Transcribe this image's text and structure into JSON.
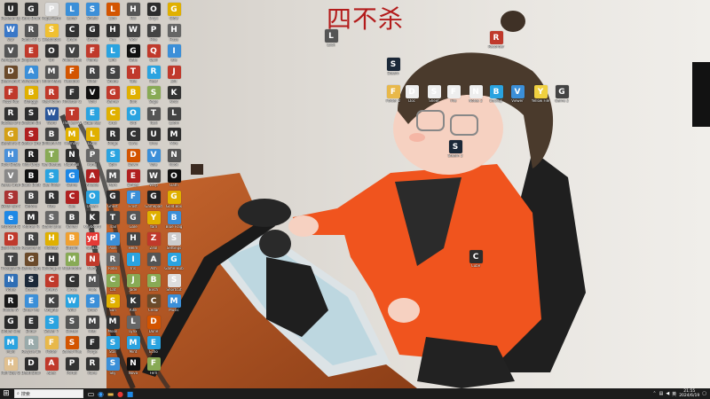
{
  "wallpaper": {
    "title": "四不杀"
  },
  "desktop_icons": [
    {
      "label": "Reslead Up",
      "color": "#2b2b2b",
      "g": "U"
    },
    {
      "label": "War",
      "color": "#3a78c8",
      "g": "W"
    },
    {
      "label": "Verlagerun Messum",
      "color": "#555",
      "g": "V"
    },
    {
      "label": "Dead and Breaken",
      "color": "#6b4a2a",
      "g": "D"
    },
    {
      "label": "Fuzzl Rut",
      "color": "#c0392b",
      "g": "F"
    },
    {
      "label": "Racket of the Bikes",
      "color": "#333",
      "g": "R"
    },
    {
      "label": "Geraint's Geoum",
      "color": "#d4a017",
      "g": "G"
    },
    {
      "label": "Hold Shake",
      "color": "#4a90d9",
      "g": "H"
    },
    {
      "label": "Verse Chart Charter",
      "color": "#888",
      "g": "V"
    },
    {
      "label": "Siklar ein Manaraksen",
      "color": "#a33",
      "g": "S"
    },
    {
      "label": "Microsoft Edge",
      "color": "#1e88e5",
      "g": "e"
    },
    {
      "label": "Dark Reckon",
      "color": "#c0392b",
      "g": "D"
    },
    {
      "label": "Thought Rock",
      "color": "#444",
      "g": "T"
    },
    {
      "label": "Notes",
      "color": "#2f6eb5",
      "g": "N"
    },
    {
      "label": "Riddle IV",
      "color": "#1a1a1a",
      "g": "R"
    },
    {
      "label": "Global Chamber",
      "color": "#2b2b2b",
      "g": "G"
    },
    {
      "label": "Muki",
      "color": "#2aa3e0",
      "g": "M"
    },
    {
      "label": "Half Day Game",
      "color": "#e0c090",
      "g": "H"
    },
    {
      "label": "Guru Brain",
      "color": "#333",
      "g": "G"
    },
    {
      "label": "Radio RP 175",
      "color": "#555",
      "g": "R"
    },
    {
      "label": "Emporium Game",
      "color": "#c0392b",
      "g": "E"
    },
    {
      "label": "Advanced Setup",
      "color": "#3b8fd8",
      "g": "A"
    },
    {
      "label": "Blarggy",
      "color": "#e0b000",
      "g": "B"
    },
    {
      "label": "Shalom Sheen",
      "color": "#2d2d2d",
      "g": "S"
    },
    {
      "label": "Stellar Dreams",
      "color": "#b02020",
      "g": "S"
    },
    {
      "label": "Riot Drop",
      "color": "#222",
      "g": "R"
    },
    {
      "label": "Black Book",
      "color": "#111",
      "g": "B"
    },
    {
      "label": "Before",
      "color": "#444",
      "g": "B"
    },
    {
      "label": "Murder R",
      "color": "#333",
      "g": "M"
    },
    {
      "label": "Reasons to Physical",
      "color": "#444",
      "g": "R"
    },
    {
      "label": "Game Spreadsheet",
      "color": "#6b4a2a",
      "g": "G"
    },
    {
      "label": "Steam",
      "color": "#1b2838",
      "g": "S"
    },
    {
      "label": "Enter Me",
      "color": "#3b8fd8",
      "g": "E"
    },
    {
      "label": "Ender",
      "color": "#333",
      "g": "E"
    },
    {
      "label": "Recycle Bin",
      "color": "#9aa",
      "g": "R"
    },
    {
      "label": "DeathDoor",
      "color": "#2d2d2d",
      "g": "D"
    },
    {
      "label": "PaperTerm",
      "color": "#ddd",
      "g": "P"
    },
    {
      "label": "Sketchbox",
      "color": "#f0c030",
      "g": "S"
    },
    {
      "label": "Ori",
      "color": "#333",
      "g": "O"
    },
    {
      "label": "Mind Matter",
      "color": "#555",
      "g": "M"
    },
    {
      "label": "Red Room",
      "color": "#c0392b",
      "g": "R"
    },
    {
      "label": "Word",
      "color": "#2b579a",
      "g": "W"
    },
    {
      "label": "Brilliant Mine",
      "color": "#444",
      "g": "B"
    },
    {
      "label": "Tea Beauty",
      "color": "#8a5",
      "g": "T"
    },
    {
      "label": "Sea Rider",
      "color": "#2aa3e0",
      "g": "S"
    },
    {
      "label": "Rise",
      "color": "#333",
      "g": "R"
    },
    {
      "label": "Stand Line",
      "color": "#666",
      "g": "S"
    },
    {
      "label": "Holiday",
      "color": "#e0b000",
      "g": "H"
    },
    {
      "label": "Holdings in Bloodskell",
      "color": "#333",
      "g": "H"
    },
    {
      "label": "Cherry",
      "color": "#c0392b",
      "g": "C"
    },
    {
      "label": "Knights",
      "color": "#444",
      "g": "K"
    },
    {
      "label": "Sewer 7",
      "color": "#2aa3e0",
      "g": "S"
    },
    {
      "label": "Folder",
      "color": "#e8b84a",
      "g": "F"
    },
    {
      "label": "Apex",
      "color": "#c0392b",
      "g": "A"
    },
    {
      "label": "Lunar",
      "color": "#3b8fd8",
      "g": "L"
    },
    {
      "label": "Chain",
      "color": "#333",
      "g": "C"
    },
    {
      "label": "Video Streak",
      "color": "#444",
      "g": "V"
    },
    {
      "label": "Feudbox",
      "color": "#d35400",
      "g": "F"
    },
    {
      "label": "Flinkster Ca",
      "color": "#333",
      "g": "F"
    },
    {
      "label": "The Cell Within",
      "color": "#c0392b",
      "g": "T"
    },
    {
      "label": "Memory",
      "color": "#e0b000",
      "g": "M"
    },
    {
      "label": "Nightfall",
      "color": "#2d2d2d",
      "g": "N"
    },
    {
      "label": "Game",
      "color": "#1e88e5",
      "g": "G"
    },
    {
      "label": "Cue",
      "color": "#b02020",
      "g": "C"
    },
    {
      "label": "Ballad",
      "color": "#444",
      "g": "B"
    },
    {
      "label": "Bitcoin",
      "color": "#f0a030",
      "g": "B"
    },
    {
      "label": "Mushroom",
      "color": "#8a5",
      "g": "M"
    },
    {
      "label": "Circle",
      "color": "#333",
      "g": "C"
    },
    {
      "label": "Wild",
      "color": "#2aa3e0",
      "g": "W"
    },
    {
      "label": "Sorted",
      "color": "#555",
      "g": "S"
    },
    {
      "label": "Saved Files",
      "color": "#d35400",
      "g": "S"
    },
    {
      "label": "Portal",
      "color": "#333",
      "g": "P"
    },
    {
      "label": "Shield",
      "color": "#3b8fd8",
      "g": "S"
    },
    {
      "label": "Grave",
      "color": "#2d2d2d",
      "g": "G"
    },
    {
      "label": "Flame",
      "color": "#c0392b",
      "g": "F"
    },
    {
      "label": "Rider",
      "color": "#444",
      "g": "R"
    },
    {
      "label": "Void",
      "color": "#111",
      "g": "V"
    },
    {
      "label": "Edge Key",
      "color": "#2aa3e0",
      "g": "E"
    },
    {
      "label": "Light",
      "color": "#e0b000",
      "g": "L"
    },
    {
      "label": "Panel",
      "color": "#666",
      "g": "P"
    },
    {
      "label": "Arcade",
      "color": "#b02020",
      "g": "A"
    },
    {
      "label": "Ocean",
      "color": "#2aa3e0",
      "g": "O"
    },
    {
      "label": "Keyboard",
      "color": "#333",
      "g": "K"
    },
    {
      "label": "Youdao",
      "color": "#e53935",
      "g": "yd"
    },
    {
      "label": "Neon",
      "color": "#c0392b",
      "g": "N"
    },
    {
      "label": "Mole",
      "color": "#555",
      "g": "M"
    },
    {
      "label": "Snow",
      "color": "#3b8fd8",
      "g": "S"
    },
    {
      "label": "Mist",
      "color": "#444",
      "g": "M"
    },
    {
      "label": "Forge",
      "color": "#2d2d2d",
      "g": "F"
    },
    {
      "label": "Rune",
      "color": "#333",
      "g": "R"
    },
    {
      "label": "Lion",
      "color": "#d35400",
      "g": "L"
    },
    {
      "label": "Hat",
      "color": "#333",
      "g": "H"
    },
    {
      "label": "Link",
      "color": "#2aa3e0",
      "g": "L"
    },
    {
      "label": "Shade",
      "color": "#444",
      "g": "S"
    },
    {
      "label": "Gamer",
      "color": "#c0392b",
      "g": "G"
    },
    {
      "label": "Crux",
      "color": "#e0b000",
      "g": "C"
    },
    {
      "label": "Ridge",
      "color": "#333",
      "g": "R"
    },
    {
      "label": "Spin",
      "color": "#2aa3e0",
      "g": "S"
    },
    {
      "label": "Mark",
      "color": "#555",
      "g": "M"
    },
    {
      "label": "Ghost",
      "color": "#2d2d2d",
      "g": "G"
    },
    {
      "label": "Trail",
      "color": "#444",
      "g": "T"
    },
    {
      "label": "Pixel",
      "color": "#3b8fd8",
      "g": "P"
    },
    {
      "label": "Robo",
      "color": "#666",
      "g": "R"
    },
    {
      "label": "Cat",
      "color": "#8a5",
      "g": "C"
    },
    {
      "label": "Sun",
      "color": "#e0b000",
      "g": "S"
    },
    {
      "label": "Moon",
      "color": "#333",
      "g": "M"
    },
    {
      "label": "Star",
      "color": "#2aa3e0",
      "g": "S"
    },
    {
      "label": "Sky",
      "color": "#3b8fd8",
      "g": "S"
    },
    {
      "label": "Hill",
      "color": "#555",
      "g": "H"
    },
    {
      "label": "Wolf",
      "color": "#444",
      "g": "W"
    },
    {
      "label": "Gate",
      "color": "#111",
      "g": "G"
    },
    {
      "label": "Tale",
      "color": "#c0392b",
      "g": "T"
    },
    {
      "label": "Bolt",
      "color": "#e0b000",
      "g": "B"
    },
    {
      "label": "Orb",
      "color": "#2aa3e0",
      "g": "O"
    },
    {
      "label": "Cove",
      "color": "#333",
      "g": "C"
    },
    {
      "label": "Dawn",
      "color": "#d35400",
      "g": "D"
    },
    {
      "label": "Ember",
      "color": "#b02020",
      "g": "E"
    },
    {
      "label": "Frost",
      "color": "#3b8fd8",
      "g": "F"
    },
    {
      "label": "Gale",
      "color": "#555",
      "g": "G"
    },
    {
      "label": "Helm",
      "color": "#444",
      "g": "H"
    },
    {
      "label": "Iris",
      "color": "#2aa3e0",
      "g": "I"
    },
    {
      "label": "Jade",
      "color": "#8a5",
      "g": "J"
    },
    {
      "label": "Kite",
      "color": "#333",
      "g": "K"
    },
    {
      "label": "Lynx",
      "color": "#666",
      "g": "L"
    },
    {
      "label": "Mint",
      "color": "#2aa3e0",
      "g": "M"
    },
    {
      "label": "Nova",
      "color": "#111",
      "g": "N"
    },
    {
      "label": "Onyx",
      "color": "#2d2d2d",
      "g": "O"
    },
    {
      "label": "Pike",
      "color": "#444",
      "g": "P"
    },
    {
      "label": "Quill",
      "color": "#c0392b",
      "g": "Q"
    },
    {
      "label": "Reef",
      "color": "#2aa3e0",
      "g": "R"
    },
    {
      "label": "Sage",
      "color": "#8a5",
      "g": "S"
    },
    {
      "label": "Tusk",
      "color": "#555",
      "g": "T"
    },
    {
      "label": "Ursa",
      "color": "#333",
      "g": "U"
    },
    {
      "label": "Vale",
      "color": "#3b8fd8",
      "g": "V"
    },
    {
      "label": "Wisp",
      "color": "#444",
      "g": "W"
    },
    {
      "label": "Gamepad",
      "color": "#222",
      "g": "G"
    },
    {
      "label": "Yarn",
      "color": "#e0b000",
      "g": "Y"
    },
    {
      "label": "Zeal",
      "color": "#c0392b",
      "g": "Z"
    },
    {
      "label": "Ash",
      "color": "#555",
      "g": "A"
    },
    {
      "label": "Birch",
      "color": "#8a5",
      "g": "B"
    },
    {
      "label": "Cedar",
      "color": "#6b4a2a",
      "g": "C"
    },
    {
      "label": "Dune",
      "color": "#d35400",
      "g": "D"
    },
    {
      "label": "Echo",
      "color": "#2aa3e0",
      "g": "E"
    },
    {
      "label": "Fern",
      "color": "#8a5",
      "g": "F"
    },
    {
      "label": "Glow",
      "color": "#e0b000",
      "g": "G"
    },
    {
      "label": "Haze",
      "color": "#666",
      "g": "H"
    },
    {
      "label": "Isle",
      "color": "#3b8fd8",
      "g": "I"
    },
    {
      "label": "Jolt",
      "color": "#c0392b",
      "g": "J"
    },
    {
      "label": "Knot",
      "color": "#333",
      "g": "K"
    },
    {
      "label": "Loom",
      "color": "#444",
      "g": "L"
    },
    {
      "label": "Mire",
      "color": "#2d2d2d",
      "g": "M"
    },
    {
      "label": "Nook",
      "color": "#555",
      "g": "N"
    },
    {
      "label": "Oath",
      "color": "#111",
      "g": "O"
    },
    {
      "label": "Gold Box",
      "color": "#e0b000",
      "g": "G"
    },
    {
      "label": "Blue Flag",
      "color": "#3b8fd8",
      "g": "B"
    },
    {
      "label": "Settings",
      "color": "#ccc",
      "g": "S"
    },
    {
      "label": "Game Hub",
      "color": "#2aa3e0",
      "g": "G"
    },
    {
      "label": "Shortcut",
      "color": "#ddd",
      "g": "S"
    },
    {
      "label": "Music",
      "color": "#3b8fd8",
      "g": "M"
    },
    {
      "label": "Lock",
      "color": "#555",
      "g": "L"
    },
    {
      "label": "Steam",
      "color": "#1b2838",
      "g": "S"
    },
    {
      "label": "Folder 2",
      "color": "#e8b84a",
      "g": "F"
    },
    {
      "label": "Doc",
      "color": "#eee",
      "g": "D"
    },
    {
      "label": "Sheet",
      "color": "#eee",
      "g": "S"
    },
    {
      "label": "File",
      "color": "#eee",
      "g": "F"
    },
    {
      "label": "Notes 2",
      "color": "#eee",
      "g": "N"
    },
    {
      "label": "Backup",
      "color": "#2aa3e0",
      "g": "B"
    },
    {
      "label": "Viewer",
      "color": "#3b8fd8",
      "g": "V"
    },
    {
      "label": "Yellow File",
      "color": "#f0d040",
      "g": "Y"
    },
    {
      "label": "Game 2",
      "color": "#444",
      "g": "G"
    },
    {
      "label": "Steam 2",
      "color": "#1b2838",
      "g": "S"
    },
    {
      "label": "Cube",
      "color": "#2d2d2d",
      "g": "C"
    },
    {
      "label": "Recorder",
      "color": "#c0392b",
      "g": "R"
    }
  ],
  "taskbar": {
    "search_placeholder": "搜索",
    "clock_time": "21:55",
    "clock_date": "2024/6/19",
    "tray_lang": "英"
  },
  "colors": {
    "taskbar_bg": "#1c1c1c",
    "title_red": "#b31b1b",
    "orange": "#f0541e"
  }
}
